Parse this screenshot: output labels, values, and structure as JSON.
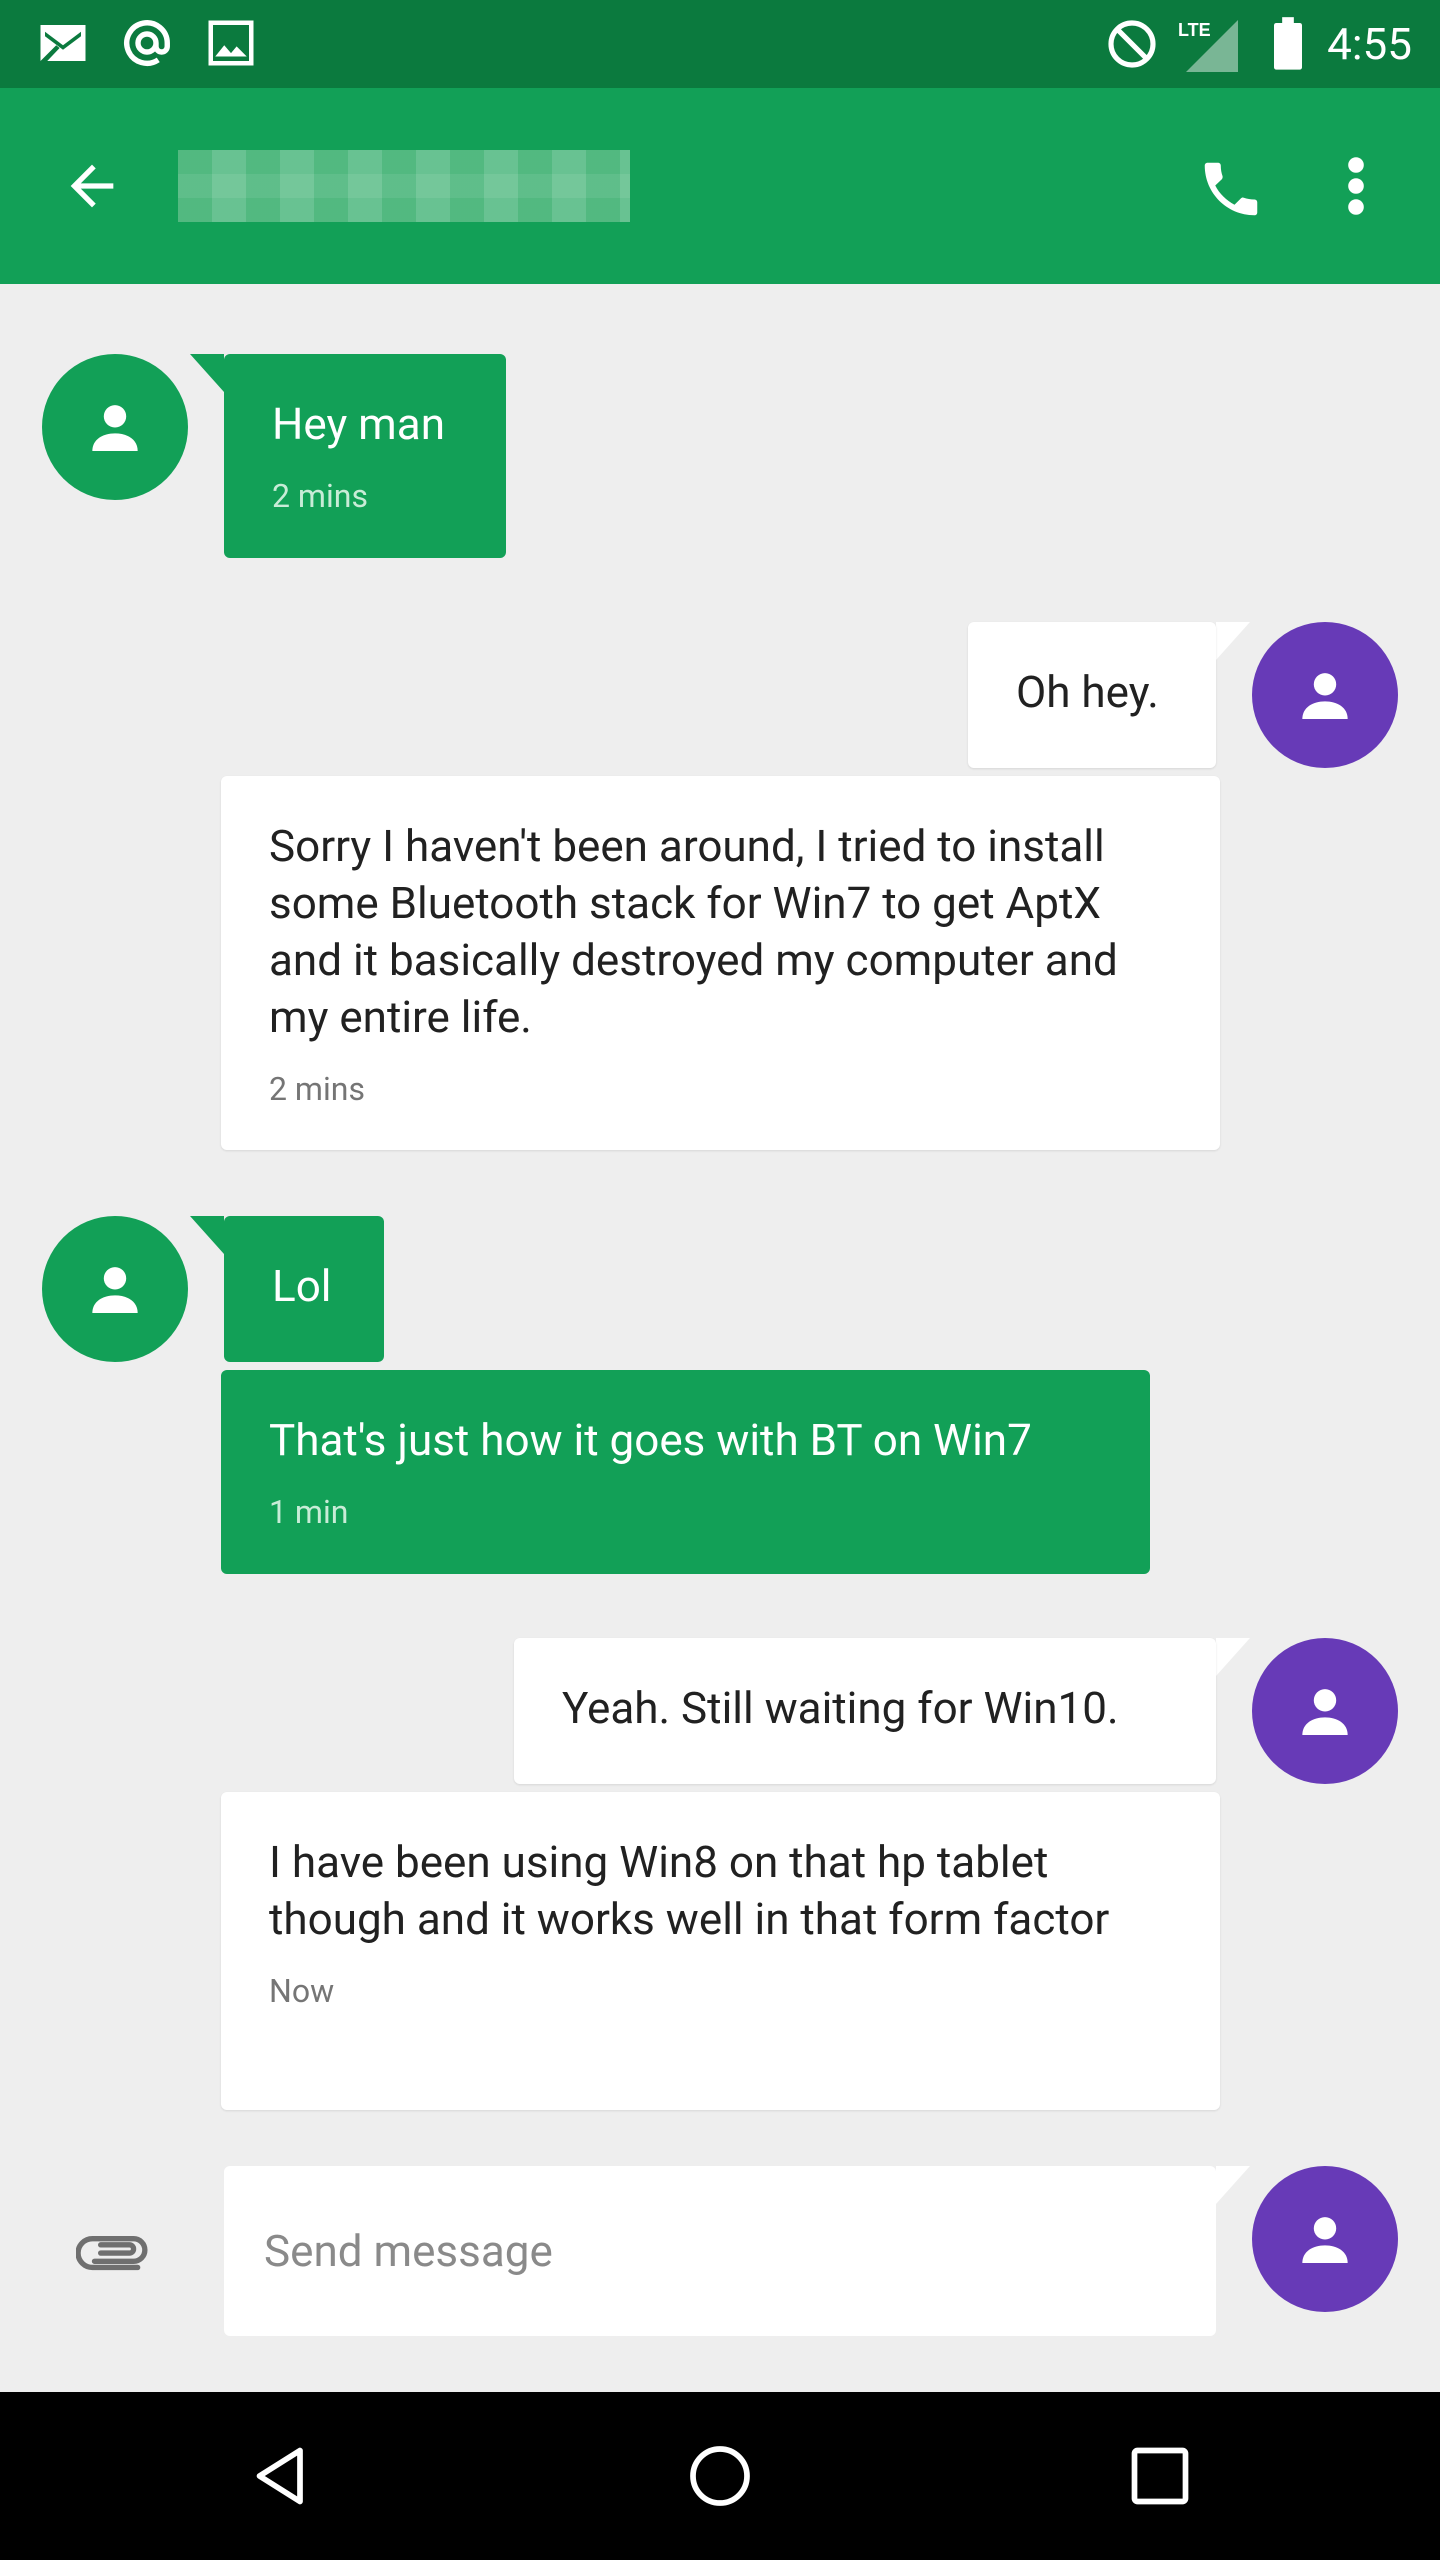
{
  "status_bar": {
    "time": "4:55",
    "network_label": "LTE",
    "icons": [
      "gmail-icon",
      "at-sign-icon",
      "image-icon",
      "do-not-disturb-icon",
      "signal-icon",
      "battery-icon"
    ]
  },
  "app_bar": {
    "contact_name": "",
    "icons": [
      "back-arrow-icon",
      "phone-icon",
      "more-vert-icon"
    ]
  },
  "messages": [
    {
      "direction": "incoming",
      "text": "Hey man",
      "time": "2 mins"
    },
    {
      "direction": "outgoing",
      "text": "Oh hey.",
      "time": ""
    },
    {
      "direction": "outgoing",
      "text": "Sorry I haven't been around, I tried to install some Bluetooth stack for Win7 to get AptX and it basically destroyed my computer and my entire life.",
      "time": "2 mins"
    },
    {
      "direction": "incoming",
      "text": "Lol",
      "time": ""
    },
    {
      "direction": "incoming",
      "text": "That's just how it goes with BT on Win7",
      "time": "1 min"
    },
    {
      "direction": "outgoing",
      "text": "Yeah. Still waiting for Win10.",
      "time": ""
    },
    {
      "direction": "outgoing",
      "text": "I have been using Win8 on that hp tablet though and it works well in that form factor",
      "time": "Now"
    }
  ],
  "compose": {
    "placeholder": "Send message",
    "value": ""
  },
  "colors": {
    "status_bar": "#0b7a3e",
    "app_bar": "#12a057",
    "incoming_bubble": "#12a057",
    "outgoing_avatar": "#673ab7",
    "background": "#eeeeee"
  }
}
